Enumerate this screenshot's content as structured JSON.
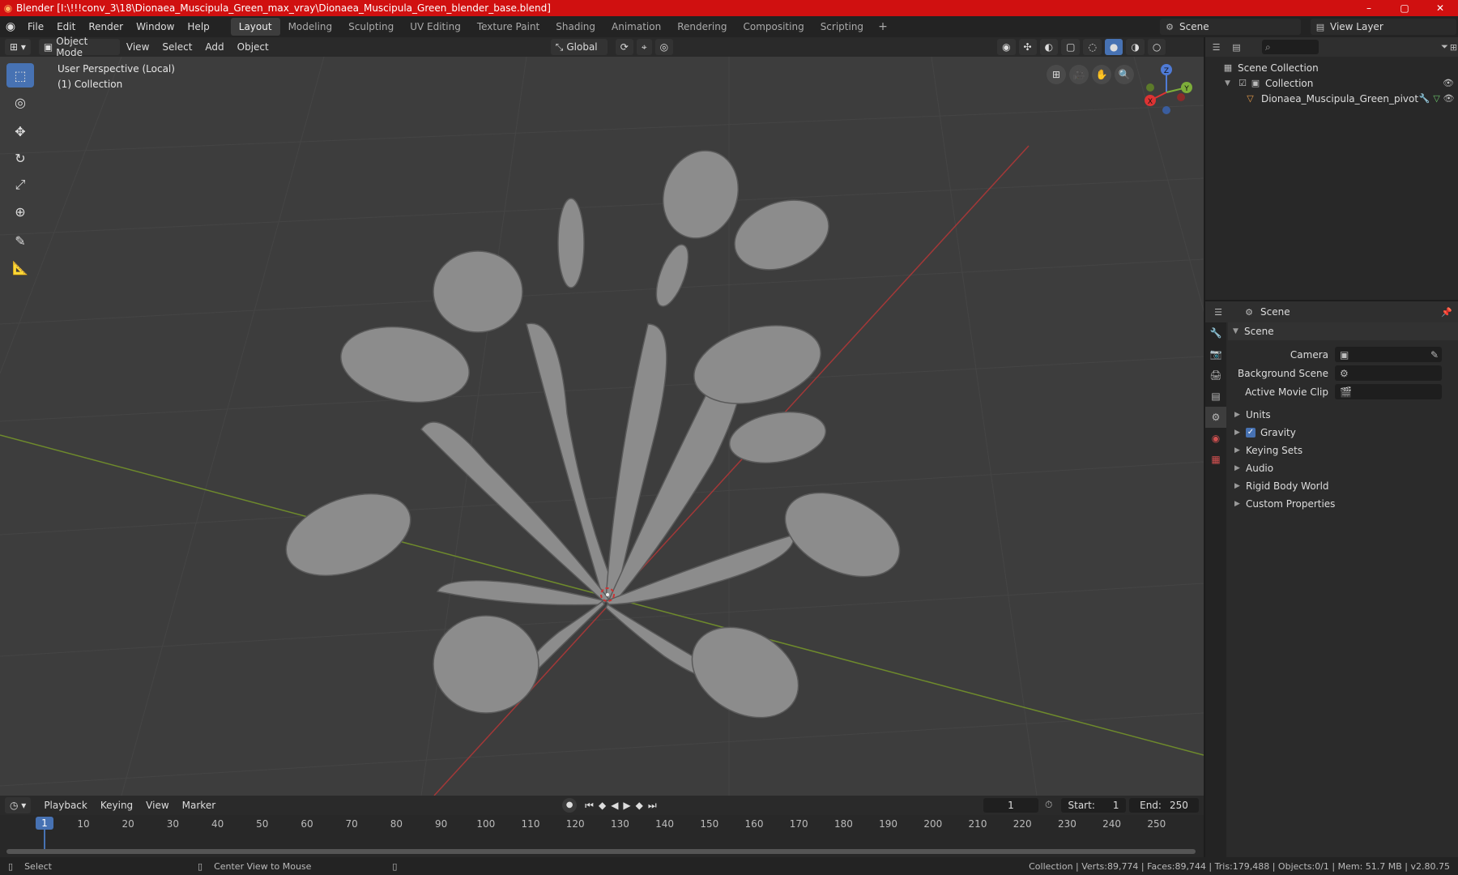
{
  "window": {
    "title": "Blender [I:\\!!!conv_3\\18\\Dionaea_Muscipula_Green_max_vray\\Dionaea_Muscipula_Green_blender_base.blend]",
    "controls": {
      "minimize": "–",
      "maximize": "▢",
      "close": "✕"
    }
  },
  "menu": {
    "items": [
      "File",
      "Edit",
      "Render",
      "Window",
      "Help"
    ]
  },
  "workspaces": {
    "tabs": [
      "Layout",
      "Modeling",
      "Sculpting",
      "UV Editing",
      "Texture Paint",
      "Shading",
      "Animation",
      "Rendering",
      "Compositing",
      "Scripting"
    ],
    "active": "Layout",
    "add": "+"
  },
  "scene": {
    "name": "Scene"
  },
  "view_layer": {
    "name": "View Layer"
  },
  "viewport_header": {
    "mode": "Object Mode",
    "menus": [
      "View",
      "Select",
      "Add",
      "Object"
    ],
    "orientation": "Global"
  },
  "viewport": {
    "perspective": "User Perspective (Local)",
    "collection": "(1) Collection",
    "gizmo": {
      "x": "X",
      "y": "Y",
      "z": "Z"
    }
  },
  "outliner": {
    "root": "Scene Collection",
    "collection": "Collection",
    "object": "Dionaea_Muscipula_Green_pivot"
  },
  "properties": {
    "context": "Scene",
    "section": "Scene",
    "camera_label": "Camera",
    "background_label": "Background Scene",
    "movieclip_label": "Active Movie Clip",
    "subpanels": [
      "Units",
      "Gravity",
      "Keying Sets",
      "Audio",
      "Rigid Body World",
      "Custom Properties"
    ],
    "gravity_checked": true
  },
  "timeline": {
    "menus": [
      "Playback",
      "Keying",
      "View",
      "Marker"
    ],
    "current_frame": "1",
    "start_label": "Start:",
    "start": "1",
    "end_label": "End:",
    "end": "250",
    "ticks": [
      "10",
      "20",
      "30",
      "40",
      "50",
      "60",
      "70",
      "80",
      "90",
      "100",
      "110",
      "120",
      "130",
      "140",
      "150",
      "160",
      "170",
      "180",
      "190",
      "200",
      "210",
      "220",
      "230",
      "240",
      "250"
    ],
    "cursor": "1"
  },
  "status": {
    "left": "Select",
    "middle": "Center View to Mouse",
    "right": "Collection | Verts:89,774 | Faces:89,744 | Tris:179,488 | Objects:0/1 | Mem: 51.7 MB | v2.80.75"
  },
  "colors": {
    "title_bar": "#d01010",
    "accent": "#4772b3",
    "x_axis": "#b03030",
    "y_axis": "#7a9a30"
  }
}
